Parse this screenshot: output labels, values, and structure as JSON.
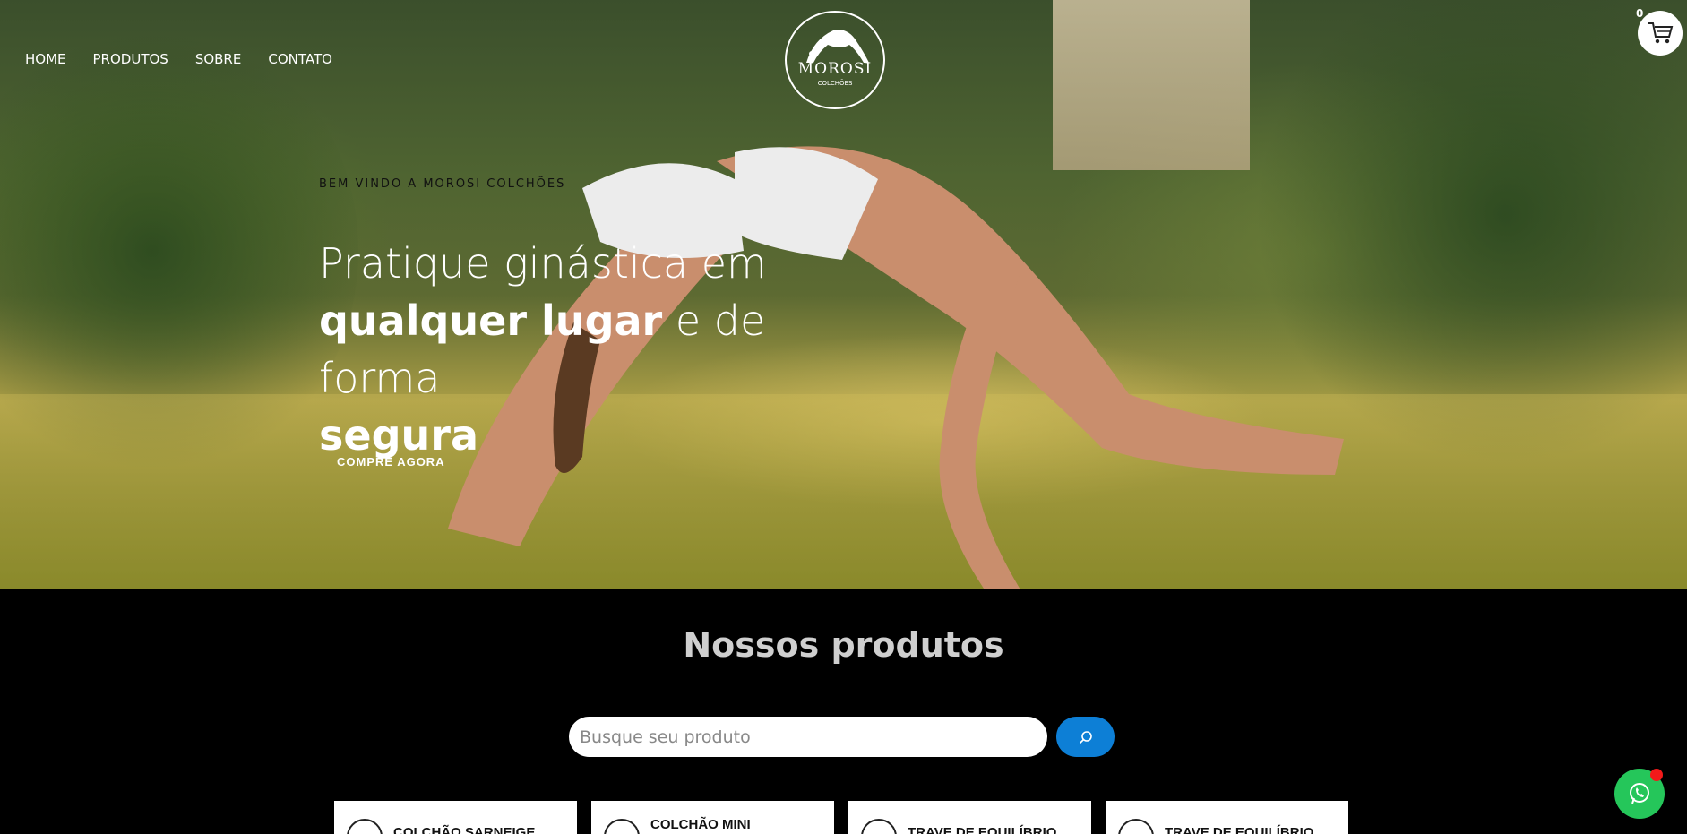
{
  "nav": {
    "items": [
      {
        "label": "HOME"
      },
      {
        "label": "PRODUTOS"
      },
      {
        "label": "SOBRE"
      },
      {
        "label": "CONTATO"
      }
    ]
  },
  "logo": {
    "brand": "MOROSI",
    "sub": "COLCHÕES"
  },
  "cart": {
    "count": "0",
    "icon": "cart-icon"
  },
  "hero": {
    "kicker": "BEM VINDO A MOROSI COLCHÕES",
    "headline_1": "Pratique ginástica em",
    "headline_bold_1": "qualquer lugar",
    "headline_2": " e de forma",
    "headline_bold_2": "segura",
    "cta_label": "COMPRE AGORA"
  },
  "products_section": {
    "title": "Nossos produtos",
    "search_placeholder": "Busque seu produto",
    "search_icon": "search-icon",
    "search_button_color": "#0d7fd6",
    "items": [
      {
        "name": "COLCHÃO SARNEIGE"
      },
      {
        "name": "COLCHÃO MINI SARNEIGE"
      },
      {
        "name": "TRAVE DE EQUILÍBRIO"
      },
      {
        "name": "TRAVE DE EQUILÍBRIO"
      }
    ]
  },
  "whatsapp": {
    "icon": "whatsapp-icon",
    "color": "#25c65a"
  }
}
